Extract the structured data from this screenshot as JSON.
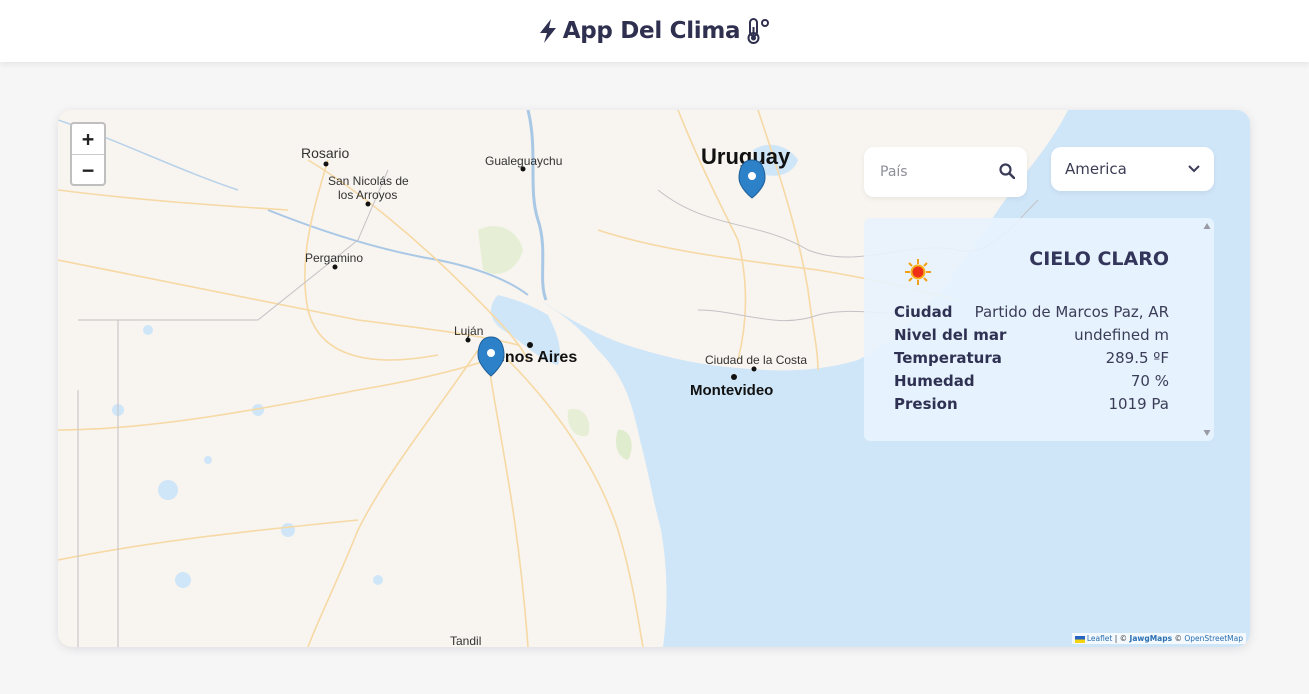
{
  "header": {
    "title": "App Del Clima"
  },
  "map": {
    "labels": {
      "rosario": "Rosario",
      "gualeguaychu": "Gualeguaychu",
      "uruguay": "Uruguay",
      "san_nicolas_1": "San Nicolás de",
      "san_nicolas_2": "los Arroyos",
      "pergamino": "Pergamino",
      "lujan": "Luján",
      "buenos_aires": "enos Aires",
      "ciudad_costa": "Ciudad de la Costa",
      "montevideo": "Montevideo",
      "tandil": "Tandil"
    },
    "zoom_in": "+",
    "zoom_out": "−",
    "attribution": {
      "leaflet": "Leaflet",
      "sep": " | © ",
      "jawg": "JawgMaps",
      "osm_sep": " © ",
      "osm": "OpenStreetMap"
    }
  },
  "controls": {
    "search_placeholder": "País",
    "region_selected": "America"
  },
  "weather": {
    "condition": "CIELO CLARO",
    "rows": [
      {
        "label": "Ciudad",
        "value": "Partido de Marcos Paz, AR"
      },
      {
        "label": "Nivel del mar",
        "value": "undefined m"
      },
      {
        "label": "Temperatura",
        "value": "289.5 ºF"
      },
      {
        "label": "Humedad",
        "value": "70 %"
      },
      {
        "label": "Presion",
        "value": "1019 Pa"
      }
    ]
  },
  "colors": {
    "land": "#f8f4ef",
    "water": "#cfe6f8",
    "marker": "#2c81c8",
    "accent": "#2f3050"
  },
  "icons": [
    "bolt-icon",
    "thermometer-icon",
    "search-icon",
    "chevron-down-icon",
    "sun-icon",
    "map-marker-icon"
  ]
}
